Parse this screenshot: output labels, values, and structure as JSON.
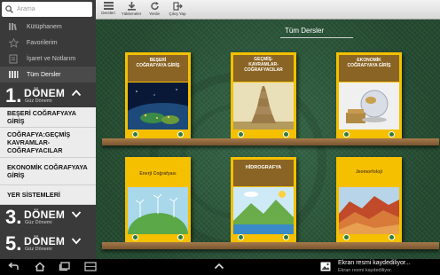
{
  "search": {
    "placeholder": "Arama"
  },
  "menu": [
    {
      "label": "Kütüphanem",
      "icon": "library-icon"
    },
    {
      "label": "Favorilerim",
      "icon": "star-icon"
    },
    {
      "label": "İşaret ve Notlarım",
      "icon": "bookmark-icon"
    },
    {
      "label": "Tüm Dersler",
      "icon": "all-courses-icon",
      "active": true
    }
  ],
  "semesters": [
    {
      "number": "1.",
      "label": "DÖNEM",
      "sub": "Güz Dönemi",
      "expanded": true
    },
    {
      "number": "3.",
      "label": "DÖNEM",
      "sub": "Güz Dönemi",
      "expanded": false
    },
    {
      "number": "5.",
      "label": "DÖNEM",
      "sub": "Güz Dönemi",
      "expanded": false
    }
  ],
  "courses": [
    "BEŞERİ COĞRAFYAYA GİRİŞ",
    "COĞRAFYA:GEÇMİŞ KAVRAMLAR-COĞRAFYACILAR",
    "EKONOMİK COĞRAFYAYA GİRİŞ",
    "YER SİSTEMLERİ"
  ],
  "toolbar": {
    "items": [
      {
        "label": "Dersleri",
        "icon": "list-icon"
      },
      {
        "label": "Yüklemeler",
        "icon": "download-icon"
      },
      {
        "label": "Yenile",
        "icon": "refresh-icon"
      },
      {
        "label": "Çıkış Yap",
        "icon": "logout-icon"
      }
    ]
  },
  "main": {
    "section_title": "Tüm Dersler"
  },
  "books": [
    {
      "title": "BEŞERİ\nCOĞRAFYAYA GİRİŞ",
      "picture": "earth-at-night"
    },
    {
      "title": "GEÇMİŞ-\nKAVRAMLAR-\nCOĞRAFYACILAR",
      "picture": "tower-of-babel"
    },
    {
      "title": "EKONOMİK\nCOĞRAFYAYA GİRİŞ",
      "picture": "glass-globe"
    },
    {
      "title": "Enerji Coğrafyası",
      "picture": "green-planet-wind-turbines"
    },
    {
      "title": "HİDROGRAFYA",
      "picture": "water-cycle"
    },
    {
      "title": "Jeomorfoloji",
      "picture": "red-rock-hills"
    }
  ],
  "notification": {
    "title": "Ekran resmi kaydediliyor...",
    "subtitle": "Ekran resmi kaydediliyor."
  },
  "colors": {
    "sidebar": "#3a3a3a",
    "course_bg": "#ececec",
    "book_yellow": "#f4c000",
    "book_band": "#8a6424",
    "shelf": "#8f6a3e"
  }
}
